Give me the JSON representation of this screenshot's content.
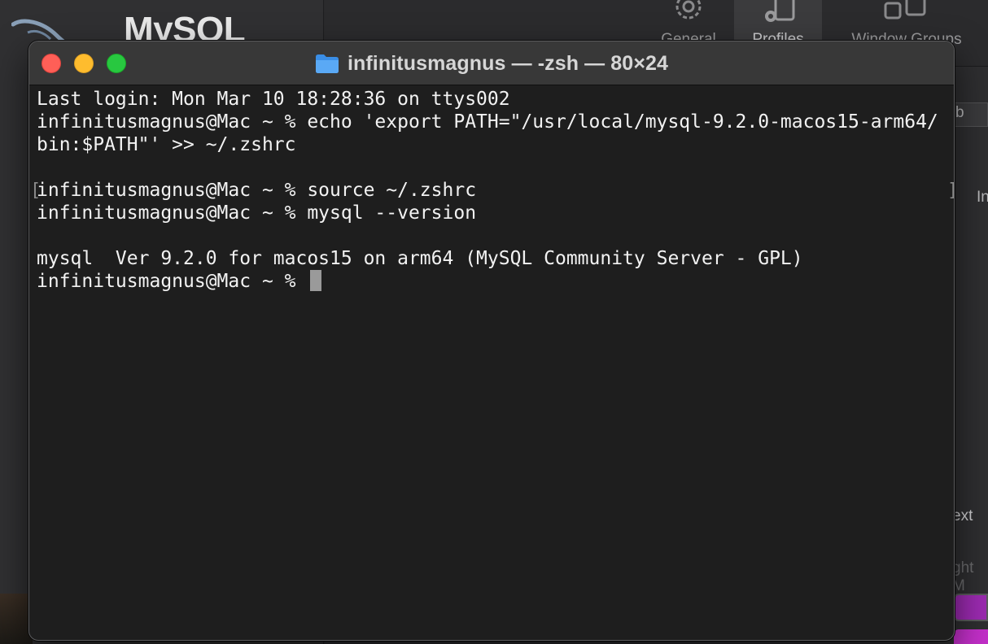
{
  "background": {
    "mysql_pane": {
      "title": "MySQL"
    },
    "settings_window": {
      "tabs": [
        {
          "label": "General",
          "icon": "gear-icon"
        },
        {
          "label": "Profiles",
          "icon": "profiles-icon"
        },
        {
          "label": "Window Groups",
          "icon": "window-groups-icon"
        }
      ],
      "fragment_tab": "b",
      "fragment_in": "In",
      "fragment_text": "ext",
      "fragment_weight": "ght M"
    }
  },
  "terminal": {
    "title": "infinitusmagnus — -zsh — 80×24",
    "folder_icon": "folder-icon",
    "lines": [
      "Last login: Mon Mar 10 18:28:36 on ttys002",
      "infinitusmagnus@Mac ~ % echo 'export PATH=\"/usr/local/mysql-9.2.0-macos15-arm64/",
      "bin:$PATH\"' >> ~/.zshrc",
      "",
      "infinitusmagnus@Mac ~ % source ~/.zshrc",
      "infinitusmagnus@Mac ~ % mysql --version",
      "",
      "mysql  Ver 9.2.0 for macos15 on arm64 (MySQL Community Server - GPL)"
    ],
    "prompt": "infinitusmagnus@Mac ~ % ",
    "colors": {
      "close": "#ff5f57",
      "minimize": "#febc2e",
      "maximize": "#28c840",
      "background": "#1e1e1e",
      "text": "#f2f2f2"
    }
  }
}
